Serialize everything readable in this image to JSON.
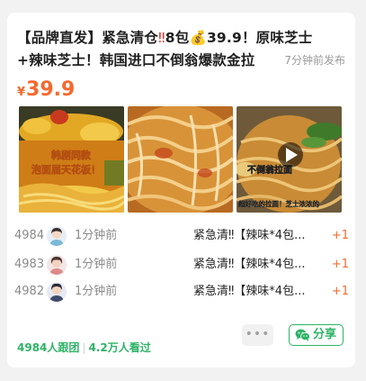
{
  "post": {
    "title": "【品牌直发】紧急清仓‼️8包💰39.9！原味芝士+辣味芝士！韩国进口不倒翁爆款金拉面",
    "title_parts": {
      "a": "【品牌直发】紧急清仓",
      "b": "‼",
      "c": "8包",
      "d": "💰",
      "e": "39.9！原味芝士",
      "f": "+辣味芝士！韩国进口不倒翁爆款金拉"
    },
    "posted_ago": "7分钟前发布",
    "price_currency": "¥",
    "price": "39.9"
  },
  "images": [
    {
      "caption_line1": "韩剧同款",
      "caption_line2": "泡面届天花板！"
    },
    {
      "caption": ""
    },
    {
      "caption_top": "不倒翁拉面",
      "caption_bottom": "超好吃的拉面！芝士浓浓的"
    }
  ],
  "followers": [
    {
      "id": "4984",
      "ago": "1分钟前",
      "message": "紧急清‼【辣味*4包...",
      "count": "+1"
    },
    {
      "id": "4983",
      "ago": "1分钟前",
      "message": "紧急清‼【辣味*4包...",
      "count": "+1"
    },
    {
      "id": "4982",
      "ago": "1分钟前",
      "message": "紧急清‼【辣味*4包...",
      "count": "+1"
    }
  ],
  "stats": {
    "joined": "4984人跟团",
    "viewed": "4.2万人看过"
  },
  "actions": {
    "more": "•••",
    "share": "分享"
  },
  "colors": {
    "accent_orange": "#f4692e",
    "accent_green": "#2db365"
  }
}
